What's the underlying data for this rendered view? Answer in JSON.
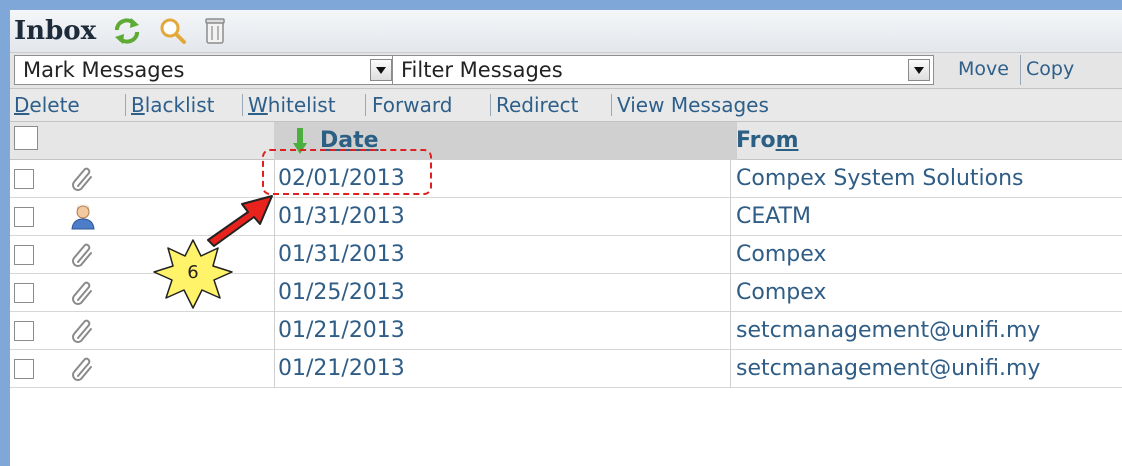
{
  "title": "Inbox",
  "toolbar": {
    "mark_select": "Mark Messages",
    "filter_select": "Filter Messages",
    "move": "Move",
    "copy": "Copy"
  },
  "actions": [
    {
      "pre": "",
      "u": "D",
      "post": "elete"
    },
    {
      "pre": "",
      "u": "B",
      "post": "lacklist"
    },
    {
      "pre": "",
      "u": "W",
      "post": "hitelist"
    },
    {
      "pre": "Forward",
      "u": "",
      "post": ""
    },
    {
      "pre": "Redirect",
      "u": "",
      "post": ""
    },
    {
      "pre": "View Messages",
      "u": "",
      "post": ""
    }
  ],
  "columns": {
    "date_pre": "Dat",
    "date_u": "e",
    "from_pre": "Fro",
    "from_u": "m",
    "from_post": ""
  },
  "rows": [
    {
      "icon": "paperclip-icon",
      "date": "02/01/2013",
      "from": "Compex System Solutions"
    },
    {
      "icon": "contact-icon",
      "date": "01/31/2013",
      "from": "CEATM"
    },
    {
      "icon": "paperclip-icon",
      "date": "01/31/2013",
      "from": "Compex"
    },
    {
      "icon": "paperclip-icon",
      "date": "01/25/2013",
      "from": "Compex"
    },
    {
      "icon": "paperclip-icon",
      "date": "01/21/2013",
      "from": "setcmanagement@unifi.my"
    },
    {
      "icon": "paperclip-icon",
      "date": "01/21/2013",
      "from": "setcmanagement@unifi.my"
    }
  ],
  "annotation": {
    "step": "6",
    "colors": {
      "box": "#e02020",
      "star": "#fff36a"
    }
  }
}
